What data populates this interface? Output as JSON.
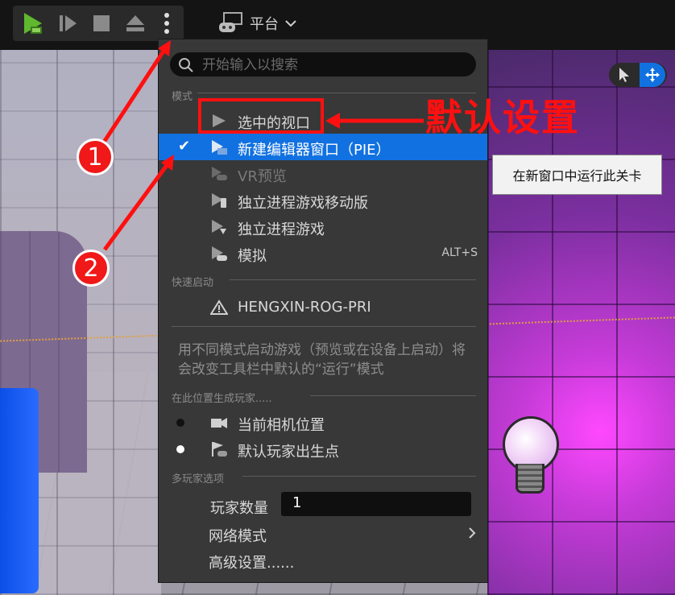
{
  "toolbar": {
    "buttons": [
      "play-icon",
      "skip-frame-icon",
      "stop-icon",
      "eject-icon",
      "more-options-icon"
    ],
    "platform_label": "平台"
  },
  "menu": {
    "search_placeholder": "开始输入以搜索",
    "section_mode": "模式",
    "items": [
      {
        "label": "选中的视口",
        "shortcut": ""
      },
      {
        "label": "新建编辑器窗口（PIE）",
        "shortcut": ""
      },
      {
        "label": "VR预览",
        "shortcut": ""
      },
      {
        "label": "独立进程游戏移动版",
        "shortcut": ""
      },
      {
        "label": "独立进程游戏",
        "shortcut": ""
      },
      {
        "label": "模拟",
        "shortcut": "ALT+S"
      }
    ],
    "section_quick_launch": "快速启动",
    "device_label": "HENGXIN-ROG-PRI",
    "description": "用不同模式启动游戏（预览或在设备上启动）将会改变工具栏中默认的“运行”模式",
    "section_spawn": "在此位置生成玩家.....",
    "spawn_options": [
      "当前相机位置",
      "默认玩家出生点"
    ],
    "section_multiplayer": "多玩家选项",
    "player_count_label": "玩家数量",
    "player_count_value": "1",
    "network_mode_label": "网络模式",
    "advanced_label": "高级设置......"
  },
  "tooltip": "在新窗口中运行此关卡",
  "annotations": {
    "default_text": "默认设置",
    "badge1": "1",
    "badge2": "2"
  },
  "colors": {
    "accent": "#1271e0",
    "annotation_red": "#ff1010",
    "play_green": "#5fb82e"
  }
}
